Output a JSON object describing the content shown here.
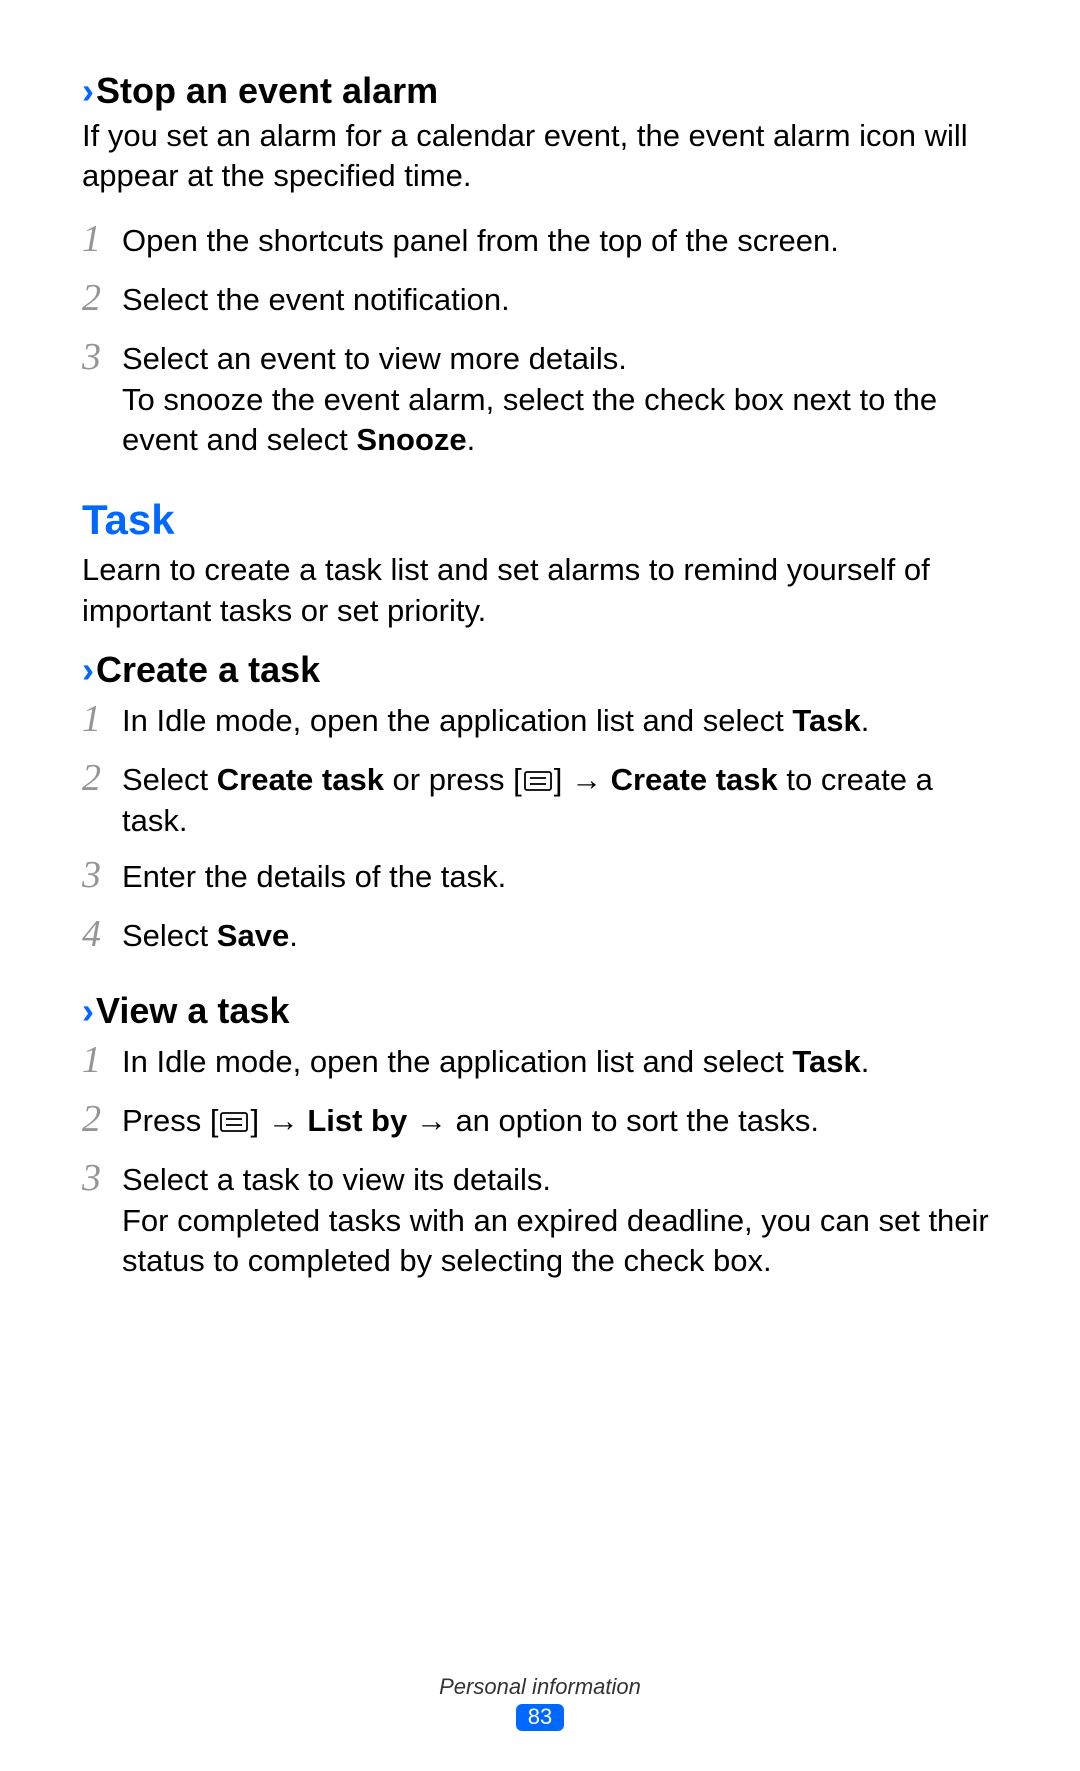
{
  "section1": {
    "chevron": "›",
    "title": "Stop an event alarm",
    "intro": "If you set an alarm for a calendar event, the event alarm icon will appear at the specified time.",
    "steps": {
      "n1": "1",
      "s1": "Open the shortcuts panel from the top of the screen.",
      "n2": "2",
      "s2": "Select the event notification.",
      "n3": "3",
      "s3a": "Select an event to view more details.",
      "s3b_pre": "To snooze the event alarm, select the check box next to the event and select ",
      "s3b_bold": "Snooze",
      "s3b_post": "."
    }
  },
  "task": {
    "heading": "Task",
    "intro": "Learn to create a task list and set alarms to remind yourself of important tasks or set priority."
  },
  "create": {
    "chevron": "›",
    "title": "Create a task",
    "steps": {
      "n1": "1",
      "s1_pre": "In Idle mode, open the application list and select ",
      "s1_bold": "Task",
      "s1_post": ".",
      "n2": "2",
      "s2_a": "Select ",
      "s2_b": "Create task",
      "s2_c": " or press [",
      "s2_d": "] → ",
      "s2_e": "Create task",
      "s2_f": " to create a task.",
      "n3": "3",
      "s3": "Enter the details of the task.",
      "n4": "4",
      "s4_pre": "Select ",
      "s4_bold": "Save",
      "s4_post": "."
    }
  },
  "view": {
    "chevron": "›",
    "title": "View a task",
    "steps": {
      "n1": "1",
      "s1_pre": "In Idle mode, open the application list and select ",
      "s1_bold": "Task",
      "s1_post": ".",
      "n2": "2",
      "s2_a": "Press [",
      "s2_b": "] → ",
      "s2_c": "List by",
      "s2_d": " → an option to sort the tasks.",
      "n3": "3",
      "s3a": "Select a task to view its details.",
      "s3b": "For completed tasks with an expired deadline, you can set their status to completed by selecting the check box."
    }
  },
  "footer": {
    "label": "Personal information",
    "page": "83"
  }
}
